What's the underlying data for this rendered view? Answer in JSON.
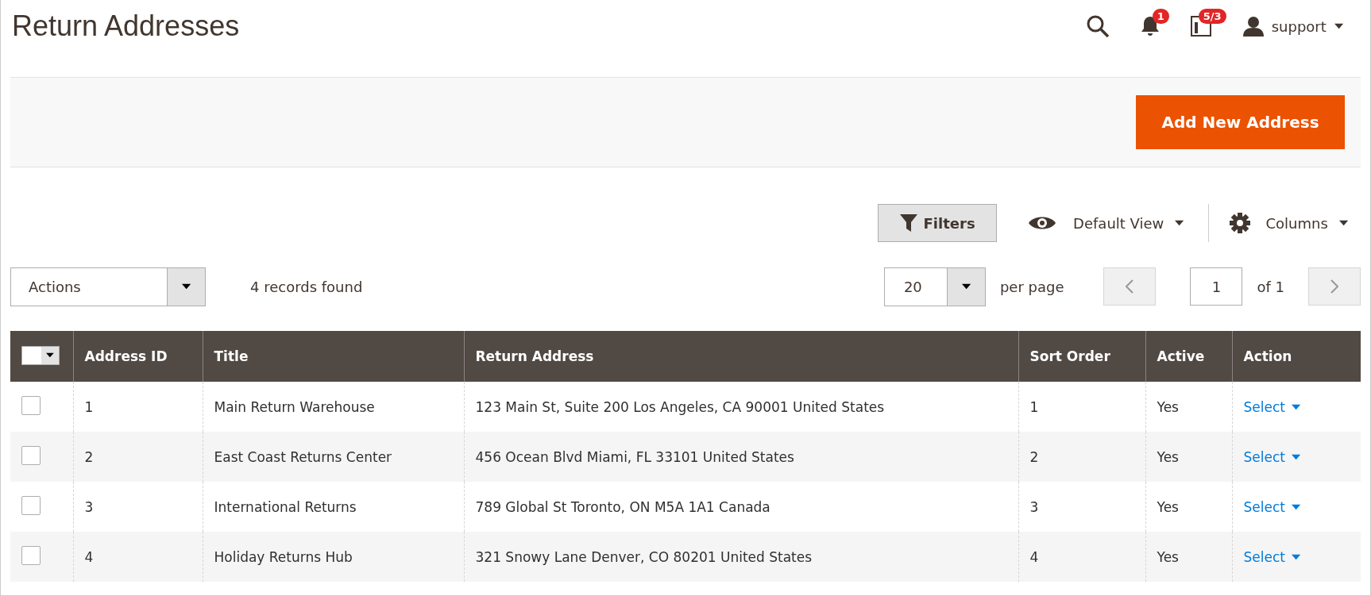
{
  "page_title": "Return Addresses",
  "header": {
    "notifications_count": "1",
    "system_messages_count": "5/3",
    "user": "support"
  },
  "primary_action": "Add New Address",
  "toolbar": {
    "filters": "Filters",
    "view": "Default View",
    "columns": "Columns"
  },
  "mass_actions": {
    "label": "Actions",
    "records_found": "4 records found",
    "select_all_checked": false
  },
  "pagination": {
    "per_page_value": "20",
    "per_page_label": "per page",
    "current_page": "1",
    "total_pages": "of 1"
  },
  "table": {
    "columns": [
      "Address ID",
      "Title",
      "Return Address",
      "Sort Order",
      "Active",
      "Action"
    ],
    "rows": [
      {
        "checked": false,
        "id": "1",
        "title": "Main Return Warehouse",
        "address": "123 Main St, Suite 200 Los Angeles, CA 90001 United States",
        "sort_order": "1",
        "active": "Yes",
        "action": "Select"
      },
      {
        "checked": false,
        "id": "2",
        "title": "East Coast Returns Center",
        "address": "456 Ocean Blvd Miami, FL 33101 United States",
        "sort_order": "2",
        "active": "Yes",
        "action": "Select"
      },
      {
        "checked": false,
        "id": "3",
        "title": "International Returns",
        "address": "789 Global St Toronto, ON M5A 1A1 Canada",
        "sort_order": "3",
        "active": "Yes",
        "action": "Select"
      },
      {
        "checked": false,
        "id": "4",
        "title": "Holiday Returns Hub",
        "address": "321 Snowy Lane Denver, CO 80201 United States",
        "sort_order": "4",
        "active": "Yes",
        "action": "Select"
      }
    ]
  }
}
